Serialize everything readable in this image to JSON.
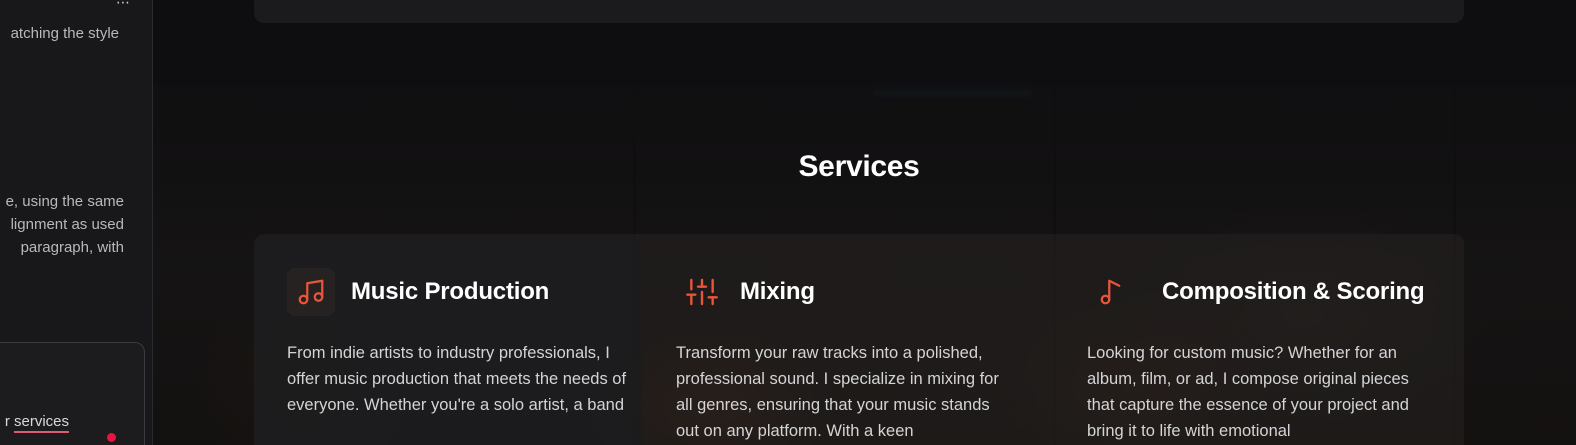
{
  "sidebar": {
    "overflow_icon": "more-icon",
    "text_top": "atching the style",
    "text_middle_lines": [
      "e, using the same",
      "lignment as used",
      "paragraph, with"
    ],
    "card_text_prefix": "r ",
    "card_text_link": "services"
  },
  "section": {
    "title": "Services"
  },
  "services": [
    {
      "icon": "music-notes-icon",
      "title": "Music Production",
      "description": "From indie artists to industry professionals, I offer music production that meets the needs of everyone. Whether you're a solo artist, a band"
    },
    {
      "icon": "sliders-icon",
      "title": "Mixing",
      "description": "Transform your raw tracks into a polished, professional sound. I specialize in mixing for all genres, ensuring that your music stands out on any platform. With a keen"
    },
    {
      "icon": "music-note-icon",
      "title": "Composition & Scoring",
      "description": "Looking for custom music? Whether for an album, film, or ad, I compose original pieces that capture the essence of your project and bring it to life with emotional"
    }
  ],
  "colors": {
    "accent": "#e8553a",
    "background": "#0e0e10",
    "sidebar": "#18181b",
    "indicator": "#e5163f"
  }
}
